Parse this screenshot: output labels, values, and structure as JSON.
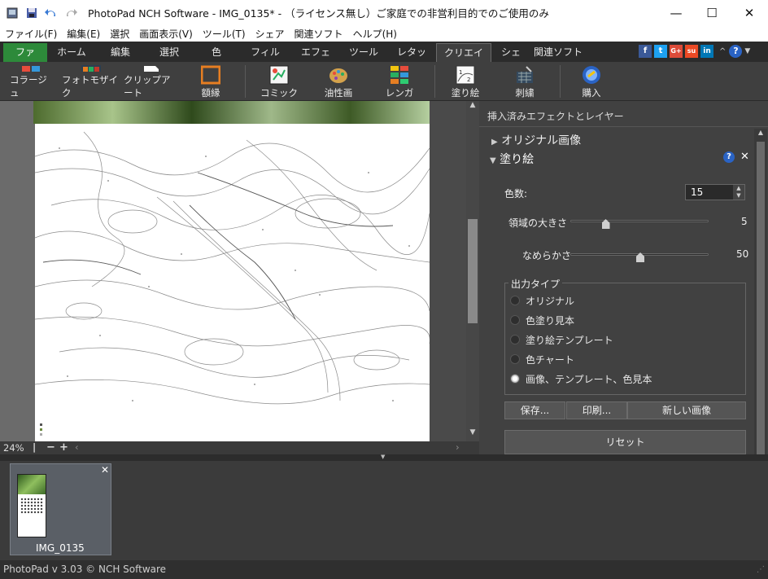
{
  "window": {
    "title": "PhotoPad NCH Software - IMG_0135* - （ライセンス無し）ご家庭での非営利目的でのご使用のみ",
    "controls": {
      "minimize": "—",
      "maximize": "☐",
      "close": "✕"
    }
  },
  "menu": [
    "ファイル(F)",
    "編集(E)",
    "選択",
    "画面表示(V)",
    "ツール(T)",
    "シェア",
    "関連ソフト",
    "ヘルプ(H)"
  ],
  "tabs": [
    "ファイル",
    "ホーム",
    "編集",
    "選択",
    "色",
    "フィルタ",
    "エフェクト",
    "ツール",
    "レタッチ",
    "クリエイティブ",
    "シェア",
    "関連ソフト"
  ],
  "active_tab": "クリエイティブ",
  "social": [
    "f",
    "t",
    "G+",
    "su",
    "in"
  ],
  "toolbar": [
    {
      "label": "コラージュ",
      "icon": "collage-icon"
    },
    {
      "label": "フォトモザイク",
      "icon": "photo-mosaic-icon"
    },
    {
      "label": "クリップアート",
      "icon": "clipart-icon"
    },
    {
      "label": "額縁",
      "icon": "frame-icon"
    },
    {
      "label": "コミック",
      "icon": "comic-icon"
    },
    {
      "label": "油性画",
      "icon": "oil-paint-icon"
    },
    {
      "label": "レンガ",
      "icon": "brick-icon"
    },
    {
      "label": "塗り絵",
      "icon": "coloring-icon"
    },
    {
      "label": "刺繍",
      "icon": "embroidery-icon"
    },
    {
      "label": "購入",
      "icon": "purchase-icon"
    }
  ],
  "zoom": "24%",
  "panel": {
    "header": "挿入済みエフェクトとレイヤー",
    "layer_original": "オリジナル画像",
    "layer_effect": "塗り絵",
    "colors_label": "色数:",
    "colors_value": "15",
    "region_label": "領域の大きさ",
    "region_value": "5",
    "region_level": 0.25,
    "smooth_label": "なめらかさ",
    "smooth_value": "50",
    "smooth_level": 0.5,
    "output_group": "出力タイプ",
    "output_options": [
      "オリジナル",
      "色塗り見本",
      "塗り絵テンプレート",
      "色チャート",
      "画像、テンプレート、色見本"
    ],
    "output_selected": 4,
    "save_btn": "保存...",
    "print_btn": "印刷...",
    "new_btn": "新しい画像",
    "reset_btn": "リセット"
  },
  "thumbnail": {
    "name": "IMG_0135"
  },
  "status": "PhotoPad v 3.03 © NCH Software"
}
